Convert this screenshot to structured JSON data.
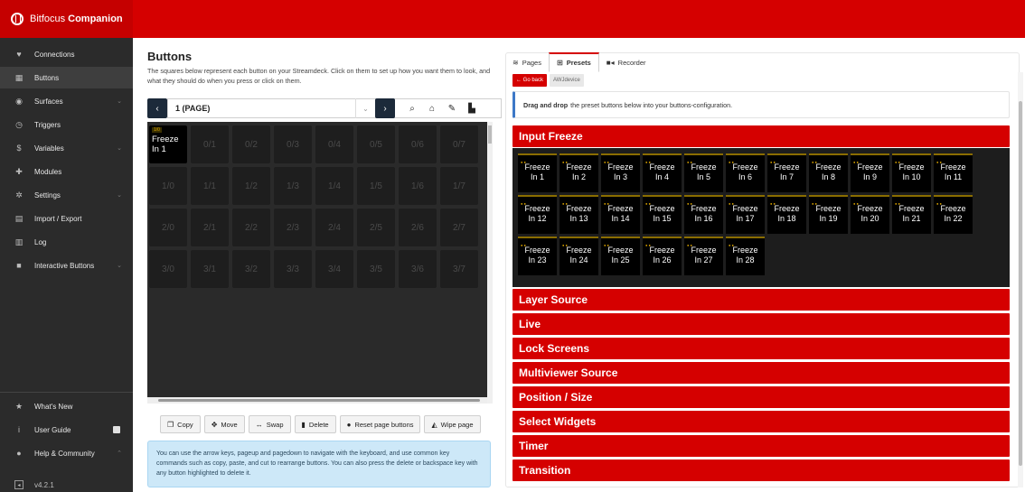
{
  "brand": {
    "light": "Bitfocus",
    "bold": "Companion"
  },
  "sidebar": {
    "items": [
      {
        "label": "Connections",
        "icon": "plug-icon"
      },
      {
        "label": "Buttons",
        "icon": "grid-icon"
      },
      {
        "label": "Surfaces",
        "icon": "gamepad-icon"
      },
      {
        "label": "Triggers",
        "icon": "clock-icon"
      },
      {
        "label": "Variables",
        "icon": "dollar-icon"
      },
      {
        "label": "Modules",
        "icon": "puzzle-icon"
      },
      {
        "label": "Settings",
        "icon": "gear-icon"
      },
      {
        "label": "Import / Export",
        "icon": "file-icon"
      },
      {
        "label": "Log",
        "icon": "clipboard-icon"
      },
      {
        "label": "Interactive Buttons",
        "icon": "square-icon"
      }
    ],
    "bottom_items": [
      {
        "label": "What's New",
        "icon": "star-icon"
      },
      {
        "label": "User Guide",
        "icon": "info-icon"
      },
      {
        "label": "Help & Community",
        "icon": "help-icon"
      }
    ],
    "version": "v4.2.1"
  },
  "buttons": {
    "title": "Buttons",
    "description": "The squares below represent each button on your Streamdeck. Click on them to set up how you want them to look, and what they should do when you press or click on them.",
    "page_value": "1 (PAGE)",
    "grid": [
      [
        "Freeze In 1",
        "0/1",
        "0/2",
        "0/3",
        "0/4",
        "0/5",
        "0/6",
        "0/7"
      ],
      [
        "1/0",
        "1/1",
        "1/2",
        "1/3",
        "1/4",
        "1/5",
        "1/6",
        "1/7"
      ],
      [
        "2/0",
        "2/1",
        "2/2",
        "2/3",
        "2/4",
        "2/5",
        "2/6",
        "2/7"
      ],
      [
        "3/0",
        "3/1",
        "3/2",
        "3/3",
        "3/4",
        "3/5",
        "3/6",
        "3/7"
      ]
    ],
    "actions": [
      "Copy",
      "Move",
      "Swap",
      "Delete",
      "Reset page buttons",
      "Wipe page"
    ],
    "hint": "You can use the arrow keys, pageup and pagedown to navigate with the keyboard, and use common key commands such as copy, paste, and cut to rearrange buttons. You can also press the delete or backspace key with any button highlighted to delete it."
  },
  "right": {
    "tabs": [
      "Pages",
      "Presets",
      "Recorder"
    ],
    "back_label": "Go back",
    "device_badge": "AWJdevice",
    "dnd_bold": "Drag and drop",
    "dnd_rest": "the preset buttons below into your buttons-configuration.",
    "categories": [
      "Input Freeze",
      "Layer Source",
      "Live",
      "Lock Screens",
      "Multiviewer Source",
      "Position / Size",
      "Select Widgets",
      "Timer",
      "Transition"
    ],
    "freeze_buttons": [
      "Freeze In 1",
      "Freeze In 2",
      "Freeze In 3",
      "Freeze In 4",
      "Freeze In 5",
      "Freeze In 6",
      "Freeze In 7",
      "Freeze In 8",
      "Freeze In 9",
      "Freeze In 10",
      "Freeze In 11",
      "Freeze In 12",
      "Freeze In 13",
      "Freeze In 14",
      "Freeze In 15",
      "Freeze In 16",
      "Freeze In 17",
      "Freeze In 18",
      "Freeze In 19",
      "Freeze In 20",
      "Freeze In 21",
      "Freeze In 22",
      "Freeze In 23",
      "Freeze In 24",
      "Freeze In 25",
      "Freeze In 26",
      "Freeze In 27",
      "Freeze In 28"
    ]
  },
  "colors": {
    "accent": "#d50000",
    "sidebar": "#2b2b2b",
    "hint_bg": "#cde8f8"
  }
}
